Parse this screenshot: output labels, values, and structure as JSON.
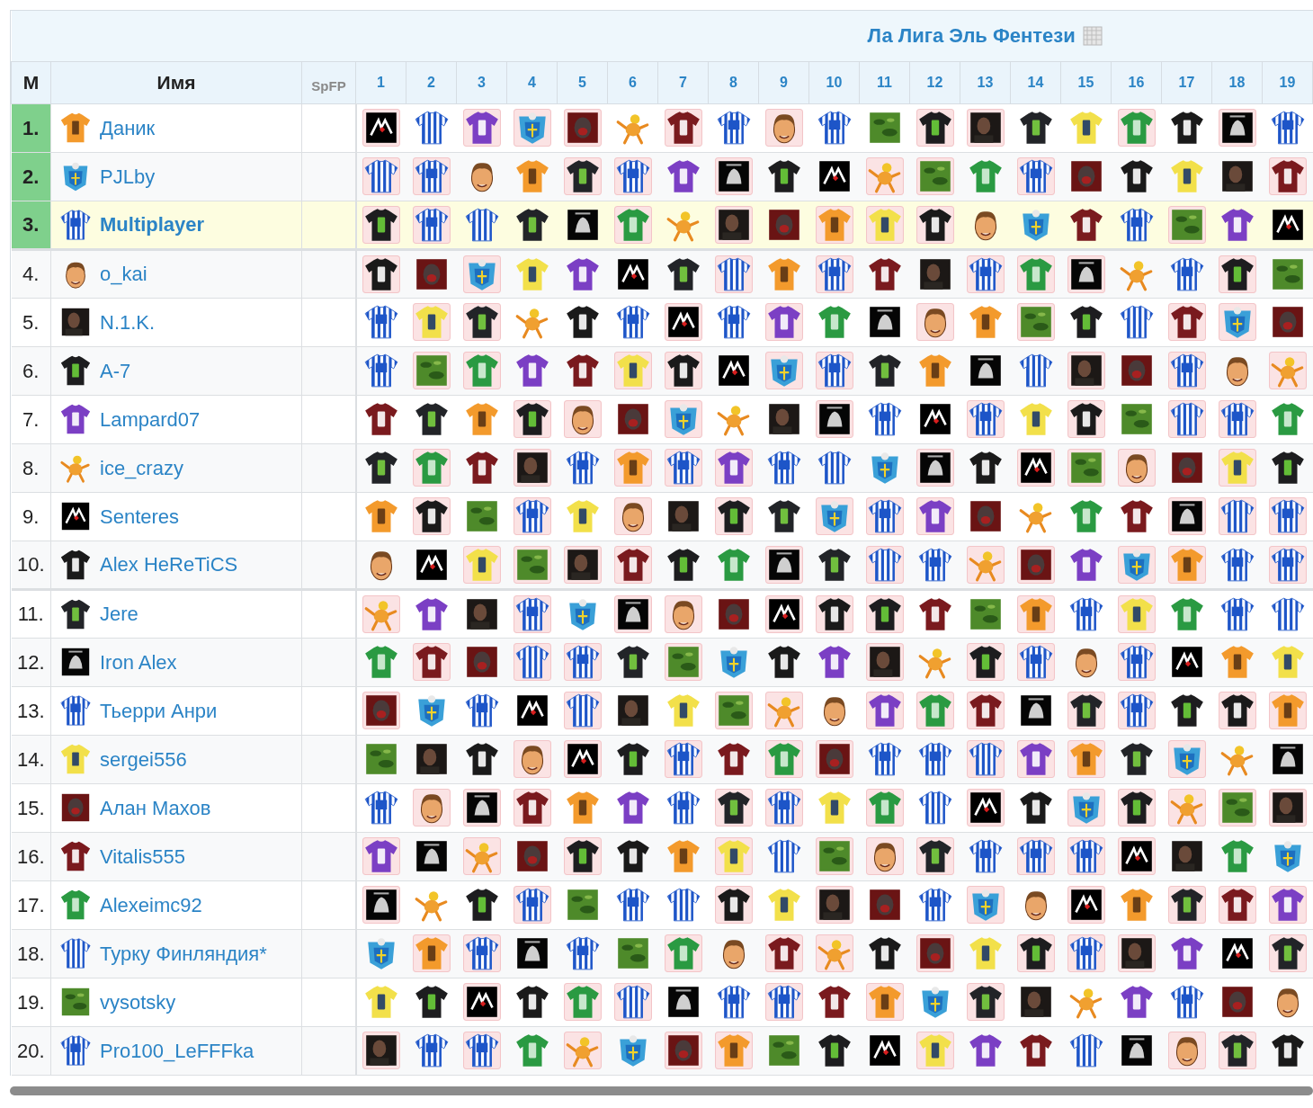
{
  "title": "Ла Лига Эль Фентези",
  "columns": {
    "rank": "М",
    "name": "Имя",
    "points": "SpFP",
    "rounds": [
      "1",
      "2",
      "3",
      "4",
      "5",
      "6",
      "7",
      "8",
      "9",
      "10",
      "11",
      "12",
      "13",
      "14",
      "15",
      "16",
      "17",
      "18",
      "19"
    ]
  },
  "rows": [
    {
      "rank": "1.",
      "name": "Даник",
      "avatar": {
        "kind": "orange"
      },
      "top": true,
      "current": false,
      "games": [
        {
          "kind": "logo",
          "marked": true
        },
        {
          "kind": "stripes",
          "marked": false
        },
        {
          "kind": "purple",
          "marked": true
        },
        {
          "kind": "crest",
          "marked": true
        },
        {
          "kind": "photored",
          "marked": true
        },
        {
          "kind": "cartoon",
          "marked": false
        },
        {
          "kind": "maroon",
          "marked": true
        },
        {
          "kind": "stripes17",
          "marked": false
        },
        {
          "kind": "face",
          "marked": true
        },
        {
          "kind": "stripes12",
          "marked": false
        },
        {
          "kind": "camo",
          "marked": false
        },
        {
          "kind": "black83",
          "marked": true
        },
        {
          "kind": "photo",
          "marked": true
        },
        {
          "kind": "black9",
          "marked": false
        },
        {
          "kind": "yellow",
          "marked": false
        },
        {
          "kind": "green",
          "marked": true
        },
        {
          "kind": "black99",
          "marked": false
        },
        {
          "kind": "album",
          "marked": true
        },
        {
          "kind": "stripes10",
          "marked": false
        }
      ]
    },
    {
      "rank": "2.",
      "name": "PJLby",
      "avatar": {
        "kind": "crest"
      },
      "top": true,
      "current": false,
      "games": [
        {
          "kind": "stripes",
          "marked": true
        },
        {
          "kind": "stripes10",
          "marked": true
        },
        {
          "kind": "face",
          "marked": false
        },
        {
          "kind": "orange",
          "marked": false
        },
        {
          "kind": "black9",
          "marked": true
        },
        {
          "kind": "stripes17",
          "marked": true
        },
        {
          "kind": "purple",
          "marked": false
        },
        {
          "kind": "album",
          "marked": true
        },
        {
          "kind": "black83",
          "marked": false
        },
        {
          "kind": "logo",
          "marked": false
        },
        {
          "kind": "cartoon",
          "marked": true
        },
        {
          "kind": "camo",
          "marked": true
        },
        {
          "kind": "green",
          "marked": false
        },
        {
          "kind": "stripes12",
          "marked": true
        },
        {
          "kind": "photored",
          "marked": false
        },
        {
          "kind": "black99",
          "marked": false
        },
        {
          "kind": "yellow",
          "marked": false
        },
        {
          "kind": "photo",
          "marked": false
        },
        {
          "kind": "maroon",
          "marked": true
        }
      ]
    },
    {
      "rank": "3.",
      "name": "Multiplayer",
      "avatar": {
        "kind": "stripes12"
      },
      "top": true,
      "current": true,
      "games": [
        {
          "kind": "black83",
          "marked": true
        },
        {
          "kind": "stripes17",
          "marked": true
        },
        {
          "kind": "stripes",
          "marked": false
        },
        {
          "kind": "black9",
          "marked": false
        },
        {
          "kind": "album",
          "marked": false
        },
        {
          "kind": "green",
          "marked": true
        },
        {
          "kind": "cartoon",
          "marked": false
        },
        {
          "kind": "photo",
          "marked": true
        },
        {
          "kind": "photored",
          "marked": false
        },
        {
          "kind": "orange",
          "marked": true
        },
        {
          "kind": "yellow",
          "marked": true
        },
        {
          "kind": "black99",
          "marked": true
        },
        {
          "kind": "face",
          "marked": false
        },
        {
          "kind": "crest",
          "marked": false
        },
        {
          "kind": "maroon",
          "marked": false
        },
        {
          "kind": "stripes10",
          "marked": false
        },
        {
          "kind": "camo",
          "marked": true
        },
        {
          "kind": "purple",
          "marked": false
        },
        {
          "kind": "logo",
          "marked": false
        }
      ]
    },
    {
      "rank": "4.",
      "name": "o_kai",
      "avatar": {
        "kind": "face"
      },
      "top": false,
      "current": false,
      "games": [
        {
          "kind": "black99",
          "marked": true
        },
        {
          "kind": "photored",
          "marked": false
        },
        {
          "kind": "crest",
          "marked": true
        },
        {
          "kind": "yellow",
          "marked": false
        },
        {
          "kind": "purple",
          "marked": false
        },
        {
          "kind": "logo",
          "marked": false
        },
        {
          "kind": "black9",
          "marked": false
        },
        {
          "kind": "stripes",
          "marked": true
        },
        {
          "kind": "orange",
          "marked": false
        },
        {
          "kind": "stripes10",
          "marked": true
        },
        {
          "kind": "maroon",
          "marked": false
        },
        {
          "kind": "photo",
          "marked": false
        },
        {
          "kind": "stripes12",
          "marked": true
        },
        {
          "kind": "green",
          "marked": true
        },
        {
          "kind": "album",
          "marked": true
        },
        {
          "kind": "cartoon",
          "marked": false
        },
        {
          "kind": "stripes17",
          "marked": false
        },
        {
          "kind": "black83",
          "marked": true
        },
        {
          "kind": "camo",
          "marked": false
        }
      ]
    },
    {
      "rank": "5.",
      "name": "N.1.K.",
      "avatar": {
        "kind": "photo"
      },
      "top": false,
      "current": false,
      "games": [
        {
          "kind": "stripes17",
          "marked": false
        },
        {
          "kind": "yellow",
          "marked": true
        },
        {
          "kind": "black9",
          "marked": true
        },
        {
          "kind": "cartoon",
          "marked": false
        },
        {
          "kind": "black99",
          "marked": false
        },
        {
          "kind": "stripes10",
          "marked": false
        },
        {
          "kind": "logo",
          "marked": true
        },
        {
          "kind": "stripes12",
          "marked": false
        },
        {
          "kind": "purple",
          "marked": true
        },
        {
          "kind": "green",
          "marked": false
        },
        {
          "kind": "album",
          "marked": false
        },
        {
          "kind": "face",
          "marked": true
        },
        {
          "kind": "orange",
          "marked": false
        },
        {
          "kind": "camo",
          "marked": true
        },
        {
          "kind": "black83",
          "marked": false
        },
        {
          "kind": "stripes",
          "marked": false
        },
        {
          "kind": "maroon",
          "marked": true
        },
        {
          "kind": "crest",
          "marked": true
        },
        {
          "kind": "photored",
          "marked": false
        }
      ]
    },
    {
      "rank": "6.",
      "name": "A-7",
      "avatar": {
        "kind": "black83"
      },
      "top": false,
      "current": false,
      "games": [
        {
          "kind": "stripes12",
          "marked": false
        },
        {
          "kind": "camo",
          "marked": true
        },
        {
          "kind": "green",
          "marked": true
        },
        {
          "kind": "purple",
          "marked": false
        },
        {
          "kind": "maroon",
          "marked": false
        },
        {
          "kind": "yellow",
          "marked": true
        },
        {
          "kind": "black99",
          "marked": true
        },
        {
          "kind": "logo",
          "marked": false
        },
        {
          "kind": "crest",
          "marked": true
        },
        {
          "kind": "stripes17",
          "marked": true
        },
        {
          "kind": "black9",
          "marked": false
        },
        {
          "kind": "orange",
          "marked": false
        },
        {
          "kind": "album",
          "marked": false
        },
        {
          "kind": "stripes",
          "marked": false
        },
        {
          "kind": "photo",
          "marked": true
        },
        {
          "kind": "photored",
          "marked": false
        },
        {
          "kind": "stripes10",
          "marked": true
        },
        {
          "kind": "face",
          "marked": false
        },
        {
          "kind": "cartoon",
          "marked": true
        }
      ]
    },
    {
      "rank": "7.",
      "name": "Lampard07",
      "avatar": {
        "kind": "purple"
      },
      "top": false,
      "current": false,
      "games": [
        {
          "kind": "maroon",
          "marked": false
        },
        {
          "kind": "black9",
          "marked": false
        },
        {
          "kind": "orange",
          "marked": false
        },
        {
          "kind": "black83",
          "marked": true
        },
        {
          "kind": "face",
          "marked": true
        },
        {
          "kind": "photored",
          "marked": false
        },
        {
          "kind": "crest",
          "marked": true
        },
        {
          "kind": "cartoon",
          "marked": false
        },
        {
          "kind": "photo",
          "marked": false
        },
        {
          "kind": "album",
          "marked": true
        },
        {
          "kind": "stripes10",
          "marked": false
        },
        {
          "kind": "logo",
          "marked": false
        },
        {
          "kind": "stripes17",
          "marked": true
        },
        {
          "kind": "yellow",
          "marked": false
        },
        {
          "kind": "black99",
          "marked": true
        },
        {
          "kind": "camo",
          "marked": false
        },
        {
          "kind": "stripes",
          "marked": true
        },
        {
          "kind": "stripes12",
          "marked": true
        },
        {
          "kind": "green",
          "marked": false
        }
      ]
    },
    {
      "rank": "8.",
      "name": "ice_crazy",
      "avatar": {
        "kind": "cartoon"
      },
      "top": false,
      "current": false,
      "games": [
        {
          "kind": "black9",
          "marked": false
        },
        {
          "kind": "green",
          "marked": true
        },
        {
          "kind": "maroon",
          "marked": false
        },
        {
          "kind": "photo",
          "marked": true
        },
        {
          "kind": "stripes17",
          "marked": false
        },
        {
          "kind": "orange",
          "marked": true
        },
        {
          "kind": "stripes12",
          "marked": true
        },
        {
          "kind": "purple",
          "marked": true
        },
        {
          "kind": "stripes10",
          "marked": false
        },
        {
          "kind": "stripes",
          "marked": false
        },
        {
          "kind": "crest",
          "marked": false
        },
        {
          "kind": "album",
          "marked": true
        },
        {
          "kind": "black99",
          "marked": false
        },
        {
          "kind": "logo",
          "marked": true
        },
        {
          "kind": "camo",
          "marked": true
        },
        {
          "kind": "face",
          "marked": true
        },
        {
          "kind": "photored",
          "marked": false
        },
        {
          "kind": "yellow",
          "marked": true
        },
        {
          "kind": "black83",
          "marked": false
        }
      ]
    },
    {
      "rank": "9.",
      "name": "Senteres",
      "avatar": {
        "kind": "logo"
      },
      "top": false,
      "current": false,
      "games": [
        {
          "kind": "orange",
          "marked": false
        },
        {
          "kind": "black99",
          "marked": true
        },
        {
          "kind": "camo",
          "marked": false
        },
        {
          "kind": "stripes10",
          "marked": true
        },
        {
          "kind": "yellow",
          "marked": false
        },
        {
          "kind": "face",
          "marked": true
        },
        {
          "kind": "photo",
          "marked": false
        },
        {
          "kind": "black83",
          "marked": true
        },
        {
          "kind": "black9",
          "marked": false
        },
        {
          "kind": "crest",
          "marked": true
        },
        {
          "kind": "stripes17",
          "marked": true
        },
        {
          "kind": "purple",
          "marked": true
        },
        {
          "kind": "photored",
          "marked": false
        },
        {
          "kind": "cartoon",
          "marked": false
        },
        {
          "kind": "green",
          "marked": false
        },
        {
          "kind": "maroon",
          "marked": false
        },
        {
          "kind": "album",
          "marked": true
        },
        {
          "kind": "stripes",
          "marked": true
        },
        {
          "kind": "stripes12",
          "marked": true
        }
      ]
    },
    {
      "rank": "10.",
      "name": "Alex HeReTiCS",
      "avatar": {
        "kind": "black99"
      },
      "top": false,
      "current": false,
      "games": [
        {
          "kind": "face",
          "marked": false
        },
        {
          "kind": "logo",
          "marked": false
        },
        {
          "kind": "yellow",
          "marked": true
        },
        {
          "kind": "camo",
          "marked": true
        },
        {
          "kind": "photo",
          "marked": true
        },
        {
          "kind": "maroon",
          "marked": true
        },
        {
          "kind": "black83",
          "marked": false
        },
        {
          "kind": "green",
          "marked": false
        },
        {
          "kind": "album",
          "marked": true
        },
        {
          "kind": "black9",
          "marked": false
        },
        {
          "kind": "stripes",
          "marked": true
        },
        {
          "kind": "stripes12",
          "marked": false
        },
        {
          "kind": "cartoon",
          "marked": true
        },
        {
          "kind": "photored",
          "marked": true
        },
        {
          "kind": "purple",
          "marked": false
        },
        {
          "kind": "crest",
          "marked": true
        },
        {
          "kind": "orange",
          "marked": true
        },
        {
          "kind": "stripes10",
          "marked": false
        },
        {
          "kind": "stripes17",
          "marked": true
        }
      ]
    },
    {
      "rank": "11.",
      "name": "Jere",
      "avatar": {
        "kind": "black9"
      },
      "top": false,
      "current": false,
      "games": [
        {
          "kind": "cartoon",
          "marked": true
        },
        {
          "kind": "purple",
          "marked": false
        },
        {
          "kind": "photo",
          "marked": false
        },
        {
          "kind": "stripes12",
          "marked": true
        },
        {
          "kind": "crest",
          "marked": false
        },
        {
          "kind": "album",
          "marked": true
        },
        {
          "kind": "face",
          "marked": true
        },
        {
          "kind": "photored",
          "marked": false
        },
        {
          "kind": "logo",
          "marked": true
        },
        {
          "kind": "black99",
          "marked": true
        },
        {
          "kind": "black83",
          "marked": true
        },
        {
          "kind": "maroon",
          "marked": false
        },
        {
          "kind": "camo",
          "marked": false
        },
        {
          "kind": "orange",
          "marked": true
        },
        {
          "kind": "stripes10",
          "marked": false
        },
        {
          "kind": "yellow",
          "marked": true
        },
        {
          "kind": "green",
          "marked": false
        },
        {
          "kind": "stripes17",
          "marked": false
        },
        {
          "kind": "stripes",
          "marked": false
        }
      ]
    },
    {
      "rank": "12.",
      "name": "Iron Alex",
      "avatar": {
        "kind": "album"
      },
      "top": false,
      "current": false,
      "games": [
        {
          "kind": "green",
          "marked": false
        },
        {
          "kind": "maroon",
          "marked": true
        },
        {
          "kind": "photored",
          "marked": false
        },
        {
          "kind": "stripes",
          "marked": true
        },
        {
          "kind": "stripes12",
          "marked": true
        },
        {
          "kind": "black9",
          "marked": false
        },
        {
          "kind": "camo",
          "marked": true
        },
        {
          "kind": "crest",
          "marked": false
        },
        {
          "kind": "black99",
          "marked": false
        },
        {
          "kind": "purple",
          "marked": false
        },
        {
          "kind": "photo",
          "marked": true
        },
        {
          "kind": "cartoon",
          "marked": false
        },
        {
          "kind": "black83",
          "marked": true
        },
        {
          "kind": "stripes10",
          "marked": true
        },
        {
          "kind": "face",
          "marked": false
        },
        {
          "kind": "stripes17",
          "marked": true
        },
        {
          "kind": "logo",
          "marked": false
        },
        {
          "kind": "orange",
          "marked": false
        },
        {
          "kind": "yellow",
          "marked": false
        }
      ]
    },
    {
      "rank": "13.",
      "name": "Тьерри Анри",
      "avatar": {
        "kind": "stripes10"
      },
      "top": false,
      "current": false,
      "games": [
        {
          "kind": "photored",
          "marked": true
        },
        {
          "kind": "crest",
          "marked": false
        },
        {
          "kind": "stripes17",
          "marked": false
        },
        {
          "kind": "logo",
          "marked": false
        },
        {
          "kind": "stripes",
          "marked": true
        },
        {
          "kind": "photo",
          "marked": false
        },
        {
          "kind": "yellow",
          "marked": false
        },
        {
          "kind": "camo",
          "marked": true
        },
        {
          "kind": "cartoon",
          "marked": true
        },
        {
          "kind": "face",
          "marked": false
        },
        {
          "kind": "purple",
          "marked": true
        },
        {
          "kind": "green",
          "marked": true
        },
        {
          "kind": "maroon",
          "marked": true
        },
        {
          "kind": "album",
          "marked": false
        },
        {
          "kind": "black9",
          "marked": true
        },
        {
          "kind": "stripes12",
          "marked": true
        },
        {
          "kind": "black83",
          "marked": false
        },
        {
          "kind": "black99",
          "marked": true
        },
        {
          "kind": "orange",
          "marked": true
        }
      ]
    },
    {
      "rank": "14.",
      "name": "sergei556",
      "avatar": {
        "kind": "yellow"
      },
      "top": false,
      "current": false,
      "games": [
        {
          "kind": "camo",
          "marked": false
        },
        {
          "kind": "photo",
          "marked": false
        },
        {
          "kind": "black99",
          "marked": false
        },
        {
          "kind": "face",
          "marked": true
        },
        {
          "kind": "logo",
          "marked": true
        },
        {
          "kind": "black83",
          "marked": false
        },
        {
          "kind": "stripes10",
          "marked": true
        },
        {
          "kind": "maroon",
          "marked": false
        },
        {
          "kind": "green",
          "marked": true
        },
        {
          "kind": "photored",
          "marked": true
        },
        {
          "kind": "stripes12",
          "marked": false
        },
        {
          "kind": "stripes17",
          "marked": false
        },
        {
          "kind": "stripes",
          "marked": true
        },
        {
          "kind": "purple",
          "marked": true
        },
        {
          "kind": "orange",
          "marked": true
        },
        {
          "kind": "black9",
          "marked": false
        },
        {
          "kind": "crest",
          "marked": true
        },
        {
          "kind": "cartoon",
          "marked": false
        },
        {
          "kind": "album",
          "marked": false
        }
      ]
    },
    {
      "rank": "15.",
      "name": "Алан Махов",
      "avatar": {
        "kind": "photored"
      },
      "top": false,
      "current": false,
      "games": [
        {
          "kind": "stripes10",
          "marked": false
        },
        {
          "kind": "face",
          "marked": true
        },
        {
          "kind": "album",
          "marked": true
        },
        {
          "kind": "maroon",
          "marked": true
        },
        {
          "kind": "orange",
          "marked": false
        },
        {
          "kind": "purple",
          "marked": false
        },
        {
          "kind": "stripes17",
          "marked": false
        },
        {
          "kind": "black9",
          "marked": true
        },
        {
          "kind": "stripes12",
          "marked": true
        },
        {
          "kind": "yellow",
          "marked": false
        },
        {
          "kind": "green",
          "marked": true
        },
        {
          "kind": "stripes",
          "marked": false
        },
        {
          "kind": "logo",
          "marked": true
        },
        {
          "kind": "black99",
          "marked": false
        },
        {
          "kind": "crest",
          "marked": true
        },
        {
          "kind": "black83",
          "marked": true
        },
        {
          "kind": "cartoon",
          "marked": true
        },
        {
          "kind": "camo",
          "marked": true
        },
        {
          "kind": "photo",
          "marked": true
        }
      ]
    },
    {
      "rank": "16.",
      "name": "Vitalis555",
      "avatar": {
        "kind": "maroon"
      },
      "top": false,
      "current": false,
      "games": [
        {
          "kind": "purple",
          "marked": true
        },
        {
          "kind": "album",
          "marked": false
        },
        {
          "kind": "cartoon",
          "marked": true
        },
        {
          "kind": "photored",
          "marked": false
        },
        {
          "kind": "black83",
          "marked": true
        },
        {
          "kind": "black99",
          "marked": false
        },
        {
          "kind": "orange",
          "marked": false
        },
        {
          "kind": "yellow",
          "marked": true
        },
        {
          "kind": "stripes",
          "marked": false
        },
        {
          "kind": "camo",
          "marked": true
        },
        {
          "kind": "face",
          "marked": true
        },
        {
          "kind": "black9",
          "marked": true
        },
        {
          "kind": "stripes10",
          "marked": false
        },
        {
          "kind": "stripes17",
          "marked": true
        },
        {
          "kind": "stripes12",
          "marked": true
        },
        {
          "kind": "logo",
          "marked": true
        },
        {
          "kind": "photo",
          "marked": false
        },
        {
          "kind": "green",
          "marked": false
        },
        {
          "kind": "crest",
          "marked": false
        }
      ]
    },
    {
      "rank": "17.",
      "name": "Alexeimc92",
      "avatar": {
        "kind": "green"
      },
      "top": false,
      "current": false,
      "games": [
        {
          "kind": "album",
          "marked": true
        },
        {
          "kind": "cartoon",
          "marked": false
        },
        {
          "kind": "black83",
          "marked": false
        },
        {
          "kind": "stripes17",
          "marked": true
        },
        {
          "kind": "camo",
          "marked": false
        },
        {
          "kind": "stripes12",
          "marked": false
        },
        {
          "kind": "stripes",
          "marked": false
        },
        {
          "kind": "black99",
          "marked": true
        },
        {
          "kind": "yellow",
          "marked": false
        },
        {
          "kind": "photo",
          "marked": true
        },
        {
          "kind": "photored",
          "marked": false
        },
        {
          "kind": "stripes10",
          "marked": false
        },
        {
          "kind": "crest",
          "marked": true
        },
        {
          "kind": "face",
          "marked": false
        },
        {
          "kind": "logo",
          "marked": true
        },
        {
          "kind": "orange",
          "marked": false
        },
        {
          "kind": "black9",
          "marked": true
        },
        {
          "kind": "maroon",
          "marked": true
        },
        {
          "kind": "purple",
          "marked": true
        }
      ]
    },
    {
      "rank": "18.",
      "name": "Турку Финляндия*",
      "avatar": {
        "kind": "stripes"
      },
      "top": false,
      "current": false,
      "games": [
        {
          "kind": "crest",
          "marked": false
        },
        {
          "kind": "orange",
          "marked": true
        },
        {
          "kind": "stripes12",
          "marked": true
        },
        {
          "kind": "album",
          "marked": false
        },
        {
          "kind": "stripes10",
          "marked": false
        },
        {
          "kind": "camo",
          "marked": false
        },
        {
          "kind": "green",
          "marked": true
        },
        {
          "kind": "face",
          "marked": false
        },
        {
          "kind": "maroon",
          "marked": true
        },
        {
          "kind": "cartoon",
          "marked": true
        },
        {
          "kind": "black99",
          "marked": false
        },
        {
          "kind": "photored",
          "marked": true
        },
        {
          "kind": "yellow",
          "marked": false
        },
        {
          "kind": "black83",
          "marked": true
        },
        {
          "kind": "stripes17",
          "marked": true
        },
        {
          "kind": "photo",
          "marked": true
        },
        {
          "kind": "purple",
          "marked": false
        },
        {
          "kind": "logo",
          "marked": false
        },
        {
          "kind": "black9",
          "marked": true
        }
      ]
    },
    {
      "rank": "19.",
      "name": "vysotsky",
      "avatar": {
        "kind": "camo"
      },
      "top": false,
      "current": false,
      "games": [
        {
          "kind": "yellow",
          "marked": false
        },
        {
          "kind": "black83",
          "marked": false
        },
        {
          "kind": "logo",
          "marked": true
        },
        {
          "kind": "black99",
          "marked": false
        },
        {
          "kind": "green",
          "marked": true
        },
        {
          "kind": "stripes",
          "marked": true
        },
        {
          "kind": "album",
          "marked": false
        },
        {
          "kind": "stripes10",
          "marked": false
        },
        {
          "kind": "stripes17",
          "marked": true
        },
        {
          "kind": "maroon",
          "marked": false
        },
        {
          "kind": "orange",
          "marked": true
        },
        {
          "kind": "crest",
          "marked": false
        },
        {
          "kind": "black9",
          "marked": true
        },
        {
          "kind": "photo",
          "marked": false
        },
        {
          "kind": "cartoon",
          "marked": false
        },
        {
          "kind": "purple",
          "marked": false
        },
        {
          "kind": "stripes12",
          "marked": false
        },
        {
          "kind": "photored",
          "marked": false
        },
        {
          "kind": "face",
          "marked": false
        }
      ]
    },
    {
      "rank": "20.",
      "name": "Pro100_LeFFFka",
      "avatar": {
        "kind": "stripes17"
      },
      "top": false,
      "current": false,
      "games": [
        {
          "kind": "photo",
          "marked": true
        },
        {
          "kind": "stripes12",
          "marked": false
        },
        {
          "kind": "stripes10",
          "marked": true
        },
        {
          "kind": "green",
          "marked": false
        },
        {
          "kind": "cartoon",
          "marked": true
        },
        {
          "kind": "crest",
          "marked": false
        },
        {
          "kind": "photored",
          "marked": true
        },
        {
          "kind": "orange",
          "marked": true
        },
        {
          "kind": "camo",
          "marked": false
        },
        {
          "kind": "black83",
          "marked": false
        },
        {
          "kind": "logo",
          "marked": false
        },
        {
          "kind": "yellow",
          "marked": true
        },
        {
          "kind": "purple",
          "marked": false
        },
        {
          "kind": "maroon",
          "marked": false
        },
        {
          "kind": "stripes",
          "marked": false
        },
        {
          "kind": "album",
          "marked": false
        },
        {
          "kind": "face",
          "marked": true
        },
        {
          "kind": "black9",
          "marked": true
        },
        {
          "kind": "black99",
          "marked": false
        }
      ]
    }
  ]
}
